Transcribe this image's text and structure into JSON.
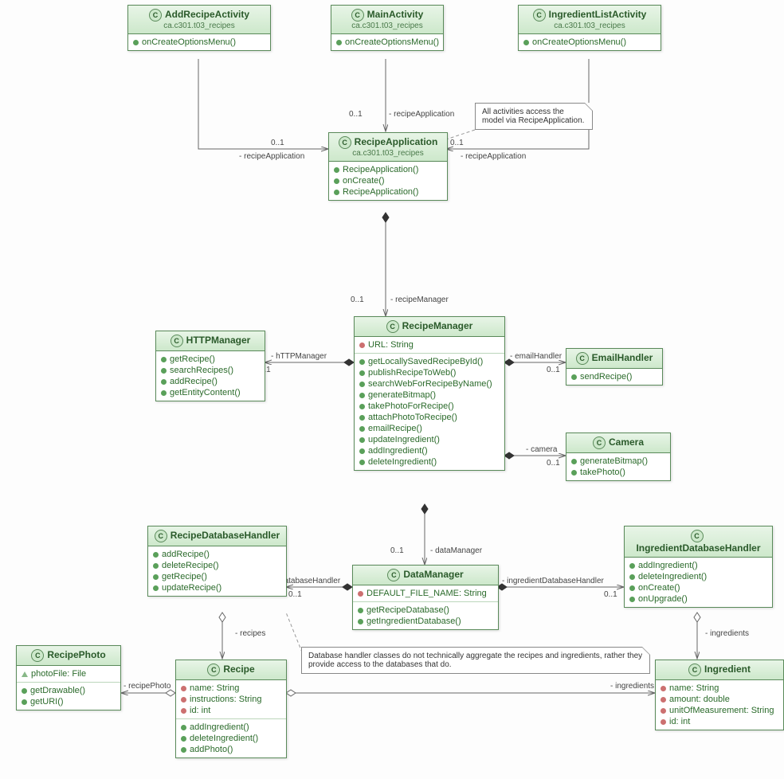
{
  "classes": {
    "addRecipeActivity": {
      "title": "AddRecipeActivity",
      "pkg": "ca.c301.t03_recipes",
      "ops": [
        "onCreateOptionsMenu()"
      ]
    },
    "mainActivity": {
      "title": "MainActivity",
      "pkg": "ca.c301.t03_recipes",
      "ops": [
        "onCreateOptionsMenu()"
      ]
    },
    "ingredientListActivity": {
      "title": "IngredientListActivity",
      "pkg": "ca.c301.t03_recipes",
      "ops": [
        "onCreateOptionsMenu()"
      ]
    },
    "recipeApplication": {
      "title": "RecipeApplication",
      "pkg": "ca.c301.t03_recipes",
      "ops": [
        "RecipeApplication()",
        "onCreate()",
        "RecipeApplication()"
      ]
    },
    "httpManager": {
      "title": "HTTPManager",
      "ops": [
        "getRecipe()",
        "searchRecipes()",
        "addRecipe()",
        "getEntityContent()"
      ]
    },
    "recipeManager": {
      "title": "RecipeManager",
      "attrs": [
        "URL: String"
      ],
      "ops": [
        "getLocallySavedRecipeById()",
        "publishRecipeToWeb()",
        "searchWebForRecipeByName()",
        "generateBitmap()",
        "takePhotoForRecipe()",
        "attachPhotoToRecipe()",
        "emailRecipe()",
        "updateIngredient()",
        "addIngredient()",
        "deleteIngredient()"
      ]
    },
    "emailHandler": {
      "title": "EmailHandler",
      "ops": [
        "sendRecipe()"
      ]
    },
    "camera": {
      "title": "Camera",
      "ops": [
        "generateBitmap()",
        "takePhoto()"
      ]
    },
    "recipeDatabaseHandler": {
      "title": "RecipeDatabaseHandler",
      "ops": [
        "addRecipe()",
        "deleteRecipe()",
        "getRecipe()",
        "updateRecipe()"
      ]
    },
    "dataManager": {
      "title": "DataManager",
      "attrs": [
        "DEFAULT_FILE_NAME: String"
      ],
      "ops": [
        "getRecipeDatabase()",
        "getIngredientDatabase()"
      ]
    },
    "ingredientDatabaseHandler": {
      "title": "IngredientDatabaseHandler",
      "ops": [
        "addIngredient()",
        "deleteIngredient()",
        "onCreate()",
        "onUpgrade()"
      ]
    },
    "recipePhoto": {
      "title": "RecipePhoto",
      "attrs": [
        "photoFile: File"
      ],
      "ops": [
        "getDrawable()",
        "getURI()"
      ]
    },
    "recipe": {
      "title": "Recipe",
      "attrs": [
        "name: String",
        "instructions: String",
        "id: int"
      ],
      "ops": [
        "addIngredient()",
        "deleteIngredient()",
        "addPhoto()"
      ]
    },
    "ingredient": {
      "title": "Ingredient",
      "attrs": [
        "name: String",
        "amount: double",
        "unitOfMeasurement: String",
        "id: int"
      ]
    }
  },
  "notes": {
    "activitiesNote": "All activities access the model via RecipeApplication.",
    "dbNote": "Database  handler classes do not technically aggregate the recipes and ingredients, rather they provide access to the databases that do."
  },
  "labels": {
    "m01": "0..1",
    "recipeApplication": "- recipeApplication",
    "hTTPManager": "- hTTPManager",
    "emailHandler": "- emailHandler",
    "camera": "- camera",
    "recipeManager": "- recipeManager",
    "dataManager": "- dataManager",
    "recipeDatabaseHandler": "- recipeDatabaseHandler",
    "ingredientDatabaseHandler": "- ingredientDatabaseHandler",
    "recipes": "- recipes",
    "ingredients": "- ingredients",
    "recipePhoto": "- recipePhoto"
  }
}
